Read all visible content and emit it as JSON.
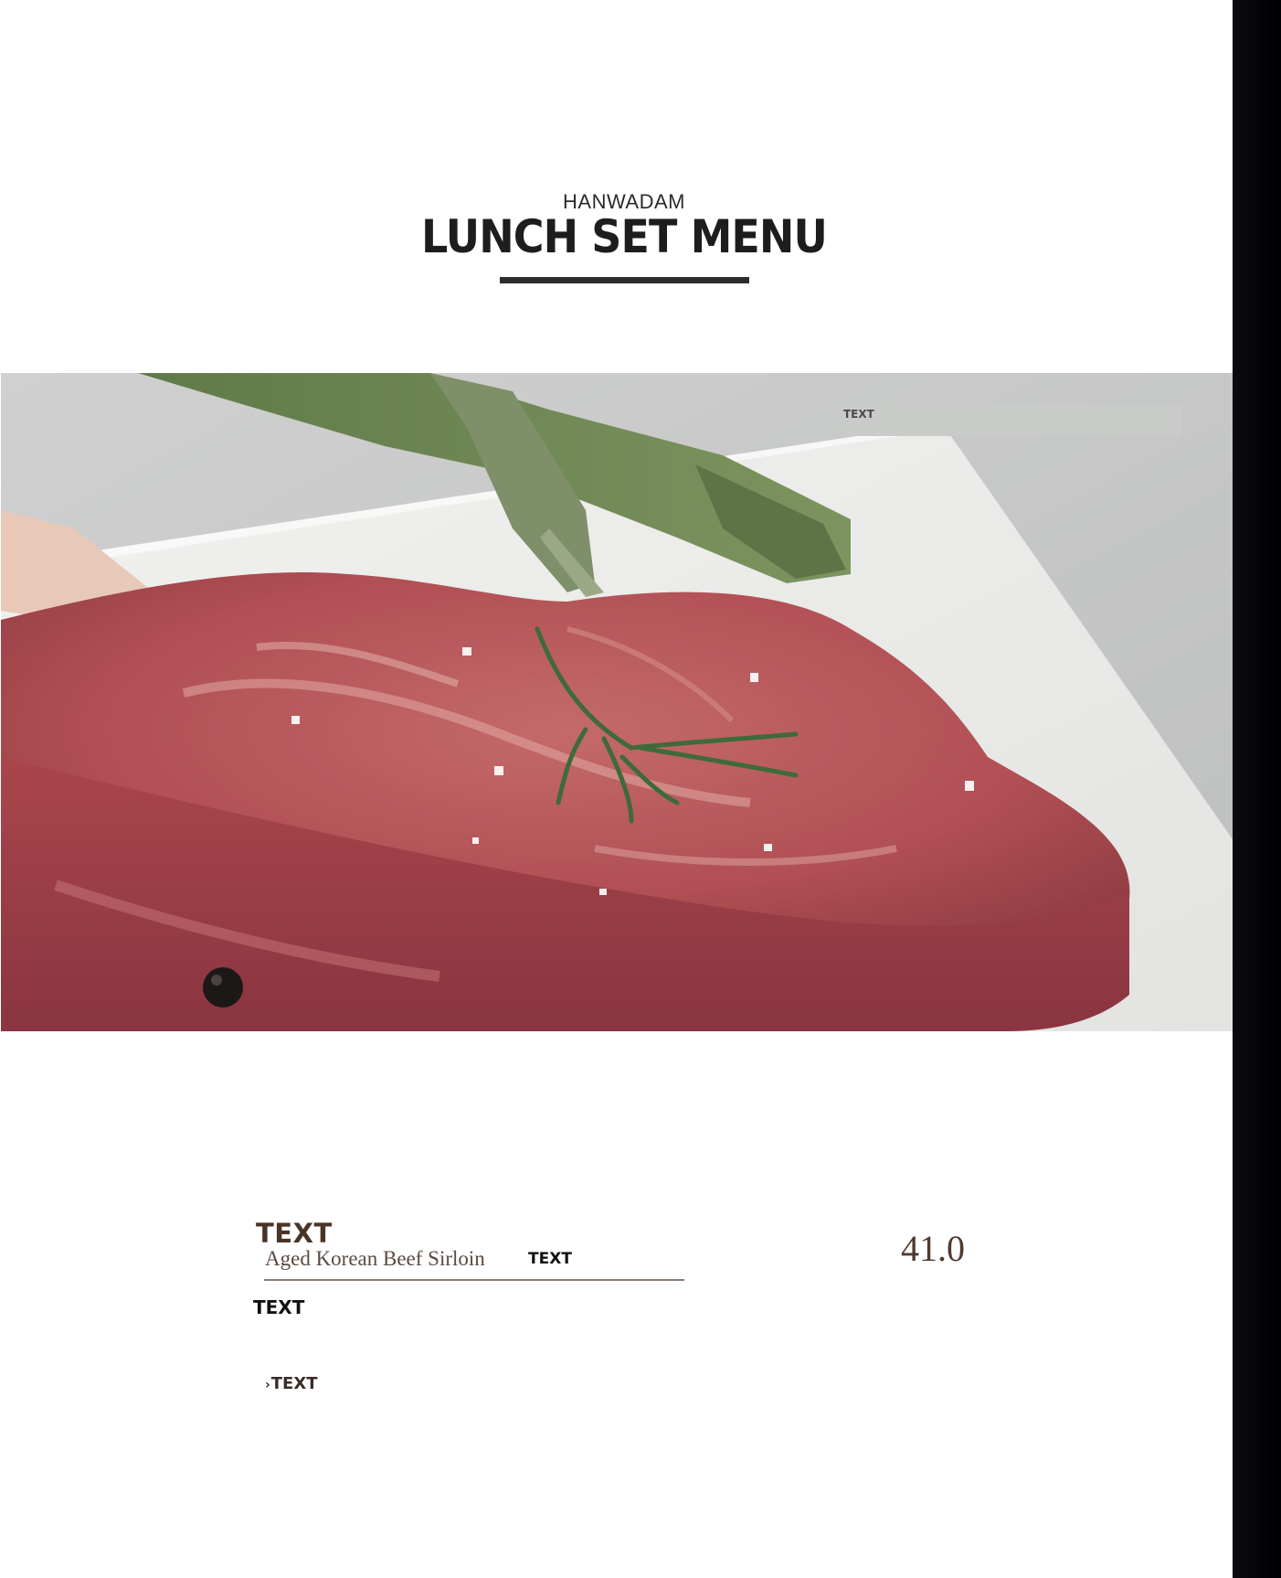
{
  "header": {
    "brand": "HANWADAM",
    "title": "LUNCH SET MENU"
  },
  "photo": {
    "tag_label": "TEXT"
  },
  "menu_item": {
    "name": "TEXT",
    "description": "Aged Korean Beef Sirloin",
    "tag": "TEXT",
    "price": "41.0",
    "note": "TEXT",
    "extra_chevron": "›",
    "extra_label": "TEXT"
  },
  "colors": {
    "page_bg": "#ffffff",
    "title_text": "#1d1d1d",
    "accent_brown": "#4a3428",
    "photo_tag_bg": "#c9cbc9",
    "right_strip": "#000003"
  }
}
